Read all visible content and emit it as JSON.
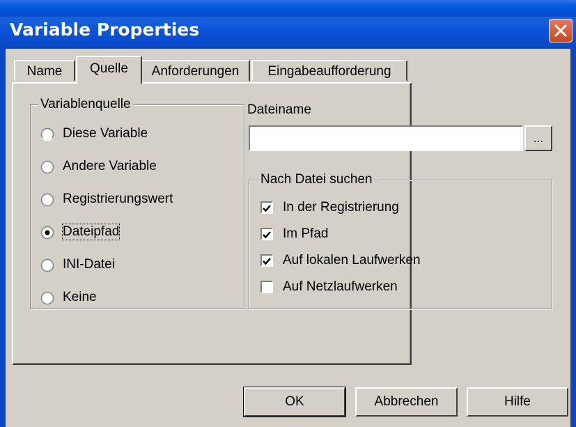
{
  "window": {
    "title": "Variable Properties"
  },
  "tabs": [
    {
      "label": "Name"
    },
    {
      "label": "Quelle",
      "active": true
    },
    {
      "label": "Anforderungen"
    },
    {
      "label": "Eingabeaufforderung"
    }
  ],
  "source_group": {
    "title": "Variablenquelle",
    "options": [
      {
        "label": "Diese Variable",
        "selected": false
      },
      {
        "label": "Andere Variable",
        "selected": false
      },
      {
        "label": "Registrierungswert",
        "selected": false
      },
      {
        "label": "Dateipfad",
        "selected": true
      },
      {
        "label": "INI-Datei",
        "selected": false
      },
      {
        "label": "Keine",
        "selected": false
      }
    ]
  },
  "filename": {
    "label": "Dateiname",
    "value": "",
    "browse_label": "..."
  },
  "search_group": {
    "title": "Nach Datei suchen",
    "options": [
      {
        "label": "In der Registrierung",
        "checked": true
      },
      {
        "label": "Im Pfad",
        "checked": true
      },
      {
        "label": "Auf lokalen Laufwerken",
        "checked": true
      },
      {
        "label": "Auf Netzlaufwerken",
        "checked": false
      }
    ]
  },
  "buttons": {
    "ok": "OK",
    "cancel": "Abbrechen",
    "help": "Hilfe"
  }
}
